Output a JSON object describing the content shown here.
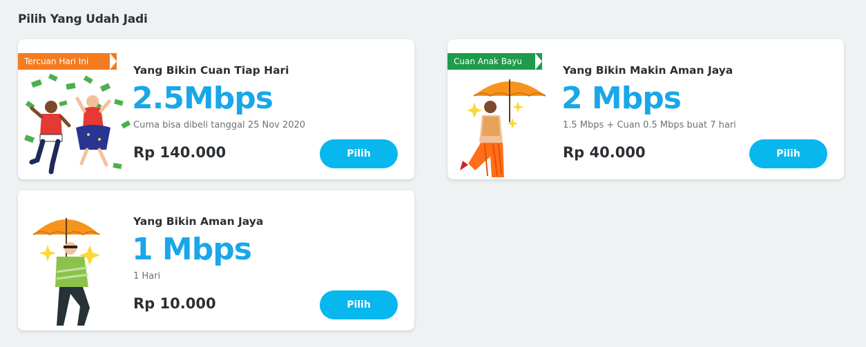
{
  "section": {
    "title": "Pilih Yang Udah Jadi"
  },
  "packages": [
    {
      "badge": "Tercuan Hari Ini",
      "name": "Yang Bikin Cuan Tiap Hari",
      "speed": "2.5Mbps",
      "note": "Cuma bisa dibeli tanggal 25 Nov 2020",
      "price": "Rp 140.000",
      "button": "Pilih"
    },
    {
      "badge": "Cuan Anak Bayu",
      "name": "Yang Bikin Makin Aman Jaya",
      "speed": "2 Mbps",
      "note": "1.5 Mbps + Cuan 0.5 Mbps buat 7 hari",
      "price": "Rp 40.000",
      "button": "Pilih"
    },
    {
      "name": "Yang Bikin Aman Jaya",
      "speed": "1 Mbps",
      "note": "1 Hari",
      "price": "Rp 10.000",
      "button": "Pilih"
    }
  ],
  "colors": {
    "accent": "#19a7e8",
    "button": "#07b7ed",
    "ribbon_orange": "#f47b20",
    "ribbon_green": "#1e9b4b"
  }
}
